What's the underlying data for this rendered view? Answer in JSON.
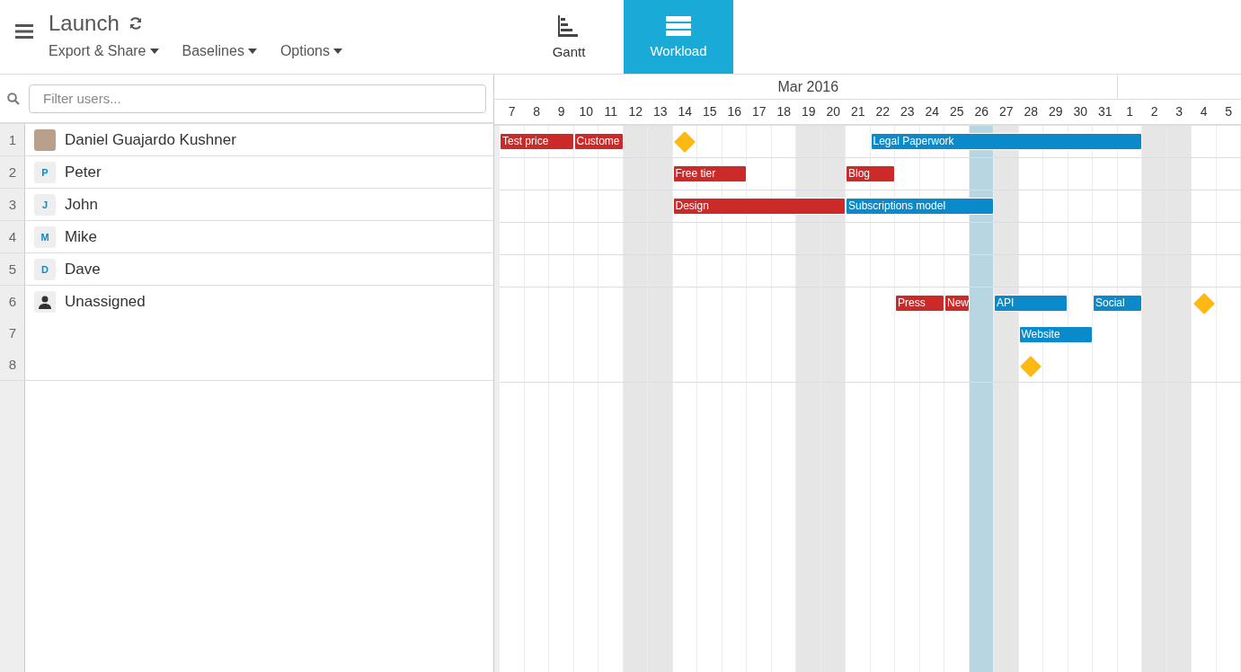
{
  "project": {
    "title": "Launch",
    "menus": [
      "Export & Share",
      "Baselines",
      "Options"
    ]
  },
  "views": [
    {
      "label": "Gantt",
      "kind": "gantt",
      "selected": false
    },
    {
      "label": "Workload",
      "kind": "workload",
      "selected": true
    }
  ],
  "filter": {
    "placeholder": "Filter users..."
  },
  "timeline": {
    "months": [
      "Mar 2016"
    ],
    "days": [
      {
        "label": "7",
        "weekend": false,
        "today": false
      },
      {
        "label": "8",
        "weekend": false,
        "today": false
      },
      {
        "label": "9",
        "weekend": false,
        "today": false
      },
      {
        "label": "10",
        "weekend": false,
        "today": false
      },
      {
        "label": "11",
        "weekend": false,
        "today": false
      },
      {
        "label": "12",
        "weekend": true,
        "today": false
      },
      {
        "label": "13",
        "weekend": true,
        "today": false
      },
      {
        "label": "14",
        "weekend": false,
        "today": false
      },
      {
        "label": "15",
        "weekend": false,
        "today": false
      },
      {
        "label": "16",
        "weekend": false,
        "today": false
      },
      {
        "label": "17",
        "weekend": false,
        "today": false
      },
      {
        "label": "18",
        "weekend": false,
        "today": false
      },
      {
        "label": "19",
        "weekend": true,
        "today": false
      },
      {
        "label": "20",
        "weekend": true,
        "today": false
      },
      {
        "label": "21",
        "weekend": false,
        "today": false
      },
      {
        "label": "22",
        "weekend": false,
        "today": false
      },
      {
        "label": "23",
        "weekend": false,
        "today": false
      },
      {
        "label": "24",
        "weekend": false,
        "today": false
      },
      {
        "label": "25",
        "weekend": false,
        "today": false
      },
      {
        "label": "26",
        "weekend": true,
        "today": true
      },
      {
        "label": "27",
        "weekend": true,
        "today": false
      },
      {
        "label": "28",
        "weekend": false,
        "today": false
      },
      {
        "label": "29",
        "weekend": false,
        "today": false
      },
      {
        "label": "30",
        "weekend": false,
        "today": false
      },
      {
        "label": "31",
        "weekend": false,
        "today": false
      },
      {
        "label": "1",
        "weekend": false,
        "today": false
      },
      {
        "label": "2",
        "weekend": true,
        "today": false
      },
      {
        "label": "3",
        "weekend": true,
        "today": false
      },
      {
        "label": "4",
        "weekend": false,
        "today": false
      },
      {
        "label": "5",
        "weekend": false,
        "today": false
      }
    ]
  },
  "users": [
    {
      "name": "Daniel Guajardo Kushner",
      "kind": "photo",
      "lanes": [
        {
          "number": "1",
          "tasks": [
            {
              "kind": "bar",
              "label": "Test price",
              "color": "#cc2929"
            },
            {
              "kind": "bar",
              "label": "Custome",
              "color": "#cc2929"
            },
            {
              "kind": "milestone"
            },
            {
              "kind": "bar",
              "label": "Legal Paperwork",
              "color": "#0a8acb"
            }
          ]
        }
      ]
    },
    {
      "name": "Peter",
      "kind": "initial",
      "initial": "P",
      "lanes": [
        {
          "number": "2",
          "tasks": [
            {
              "kind": "bar",
              "label": "Free tier",
              "color": "#cc2929"
            },
            {
              "kind": "bar",
              "label": "Blog",
              "color": "#cc2929"
            }
          ]
        }
      ]
    },
    {
      "name": "John",
      "kind": "initial",
      "initial": "J",
      "lanes": [
        {
          "number": "3",
          "tasks": [
            {
              "kind": "bar",
              "label": "Design",
              "color": "#cc2929"
            },
            {
              "kind": "bar",
              "label": "Subscriptions model",
              "color": "#0a8acb"
            }
          ]
        }
      ]
    },
    {
      "name": "Mike",
      "kind": "initial",
      "initial": "M",
      "lanes": [
        {
          "number": "4"
        }
      ]
    },
    {
      "name": "Dave",
      "kind": "initial",
      "initial": "D",
      "lanes": [
        {
          "number": "5"
        }
      ]
    },
    {
      "name": "Unassigned",
      "kind": "silhouette",
      "lanes": [
        {
          "number": "6",
          "tasks": [
            {
              "kind": "bar",
              "label": "Press",
              "color": "#cc2929"
            },
            {
              "kind": "bar",
              "label": "New",
              "color": "#cc2929"
            },
            {
              "kind": "bar",
              "label": "API",
              "color": "#0a8acb"
            },
            {
              "kind": "bar",
              "label": "Social",
              "color": "#0a8acb"
            },
            {
              "kind": "milestone"
            }
          ]
        },
        {
          "number": "7",
          "tasks": [
            {
              "kind": "bar",
              "label": "Website",
              "color": "#0a8acb"
            }
          ]
        },
        {
          "number": "8",
          "tasks": [
            {
              "kind": "milestone"
            }
          ]
        }
      ]
    }
  ]
}
